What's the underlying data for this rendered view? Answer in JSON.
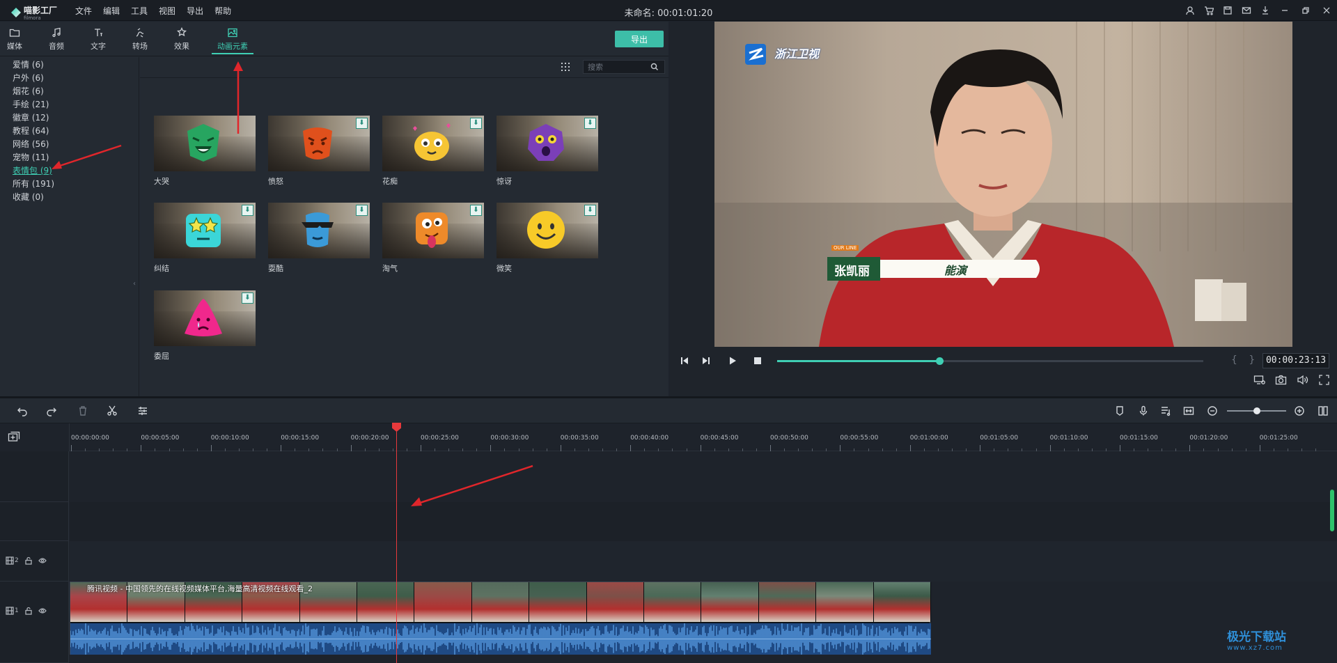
{
  "app": {
    "logo_name": "喵影工厂",
    "logo_sub": "filmora",
    "menus": [
      "文件",
      "编辑",
      "工具",
      "视图",
      "导出",
      "帮助"
    ],
    "doc_title": "未命名: 00:01:01:20",
    "title_icons": [
      "account-icon",
      "cart-icon",
      "save-icon",
      "mail-icon",
      "download-icon",
      "minimize-icon",
      "restore-icon",
      "close-icon"
    ]
  },
  "toolbar": {
    "tabs": [
      {
        "label": "媒体",
        "icon": "folder-icon"
      },
      {
        "label": "音频",
        "icon": "music-note-icon"
      },
      {
        "label": "文字",
        "icon": "text-icon"
      },
      {
        "label": "转场",
        "icon": "transition-icon"
      },
      {
        "label": "效果",
        "icon": "effects-icon"
      },
      {
        "label": "动画元素",
        "icon": "image-icon",
        "active": true
      }
    ],
    "export_label": "导出"
  },
  "categories": [
    {
      "label": "爱情 (6)"
    },
    {
      "label": "户外 (6)"
    },
    {
      "label": "烟花 (6)"
    },
    {
      "label": "手绘 (21)"
    },
    {
      "label": "徽章 (12)"
    },
    {
      "label": "教程 (64)"
    },
    {
      "label": "网络 (56)"
    },
    {
      "label": "宠物 (11)"
    },
    {
      "label": "表情包 (9)",
      "active": true
    },
    {
      "label": "所有 (191)"
    },
    {
      "label": "收藏 (0)"
    }
  ],
  "search": {
    "placeholder": "搜索",
    "value": ""
  },
  "elements": [
    {
      "label": "大哭",
      "color": "#27a560",
      "downloadable": false
    },
    {
      "label": "愤怒",
      "color": "#e0501c",
      "downloadable": true
    },
    {
      "label": "花痴",
      "color": "#f6c534",
      "downloadable": true
    },
    {
      "label": "惊讶",
      "color": "#7b3fb8",
      "downloadable": true
    },
    {
      "label": "纠结",
      "color": "#3bd6d8",
      "downloadable": true
    },
    {
      "label": "耍酷",
      "color": "#3b9ad8",
      "downloadable": true
    },
    {
      "label": "淘气",
      "color": "#ee8a2a",
      "downloadable": true
    },
    {
      "label": "微笑",
      "color": "#f7ca28",
      "downloadable": true
    },
    {
      "label": "委屈",
      "color": "#f0288c",
      "downloadable": true
    }
  ],
  "preview": {
    "channel_logo": "浙江卫视",
    "caption_name": "张凯丽",
    "caption_text": "能演",
    "caption_tag": "OUR LINE",
    "timecode": "00:00:23:13",
    "progress": 0.38
  },
  "timeline": {
    "ticks": [
      "00:00:00:00",
      "00:00:05:00",
      "00:00:10:00",
      "00:00:15:00",
      "00:00:20:00",
      "00:00:25:00",
      "00:00:30:00",
      "00:00:35:00",
      "00:00:40:00",
      "00:00:45:00",
      "00:00:50:00",
      "00:00:55:00",
      "00:01:00:00",
      "00:01:05:00",
      "00:01:10:00",
      "00:01:15:00",
      "00:01:20:00",
      "00:01:25:00"
    ],
    "tracks": [
      {
        "number": "2"
      },
      {
        "number": "1"
      }
    ],
    "clip_title": "腾讯视频 - 中国领先的在线视频媒体平台,海量高清视频在线观看_2",
    "zoom_level": 0.5,
    "playhead_time": "00:00:23:13"
  },
  "watermark": {
    "title": "极光下载站",
    "url": "www.xz7.com"
  }
}
